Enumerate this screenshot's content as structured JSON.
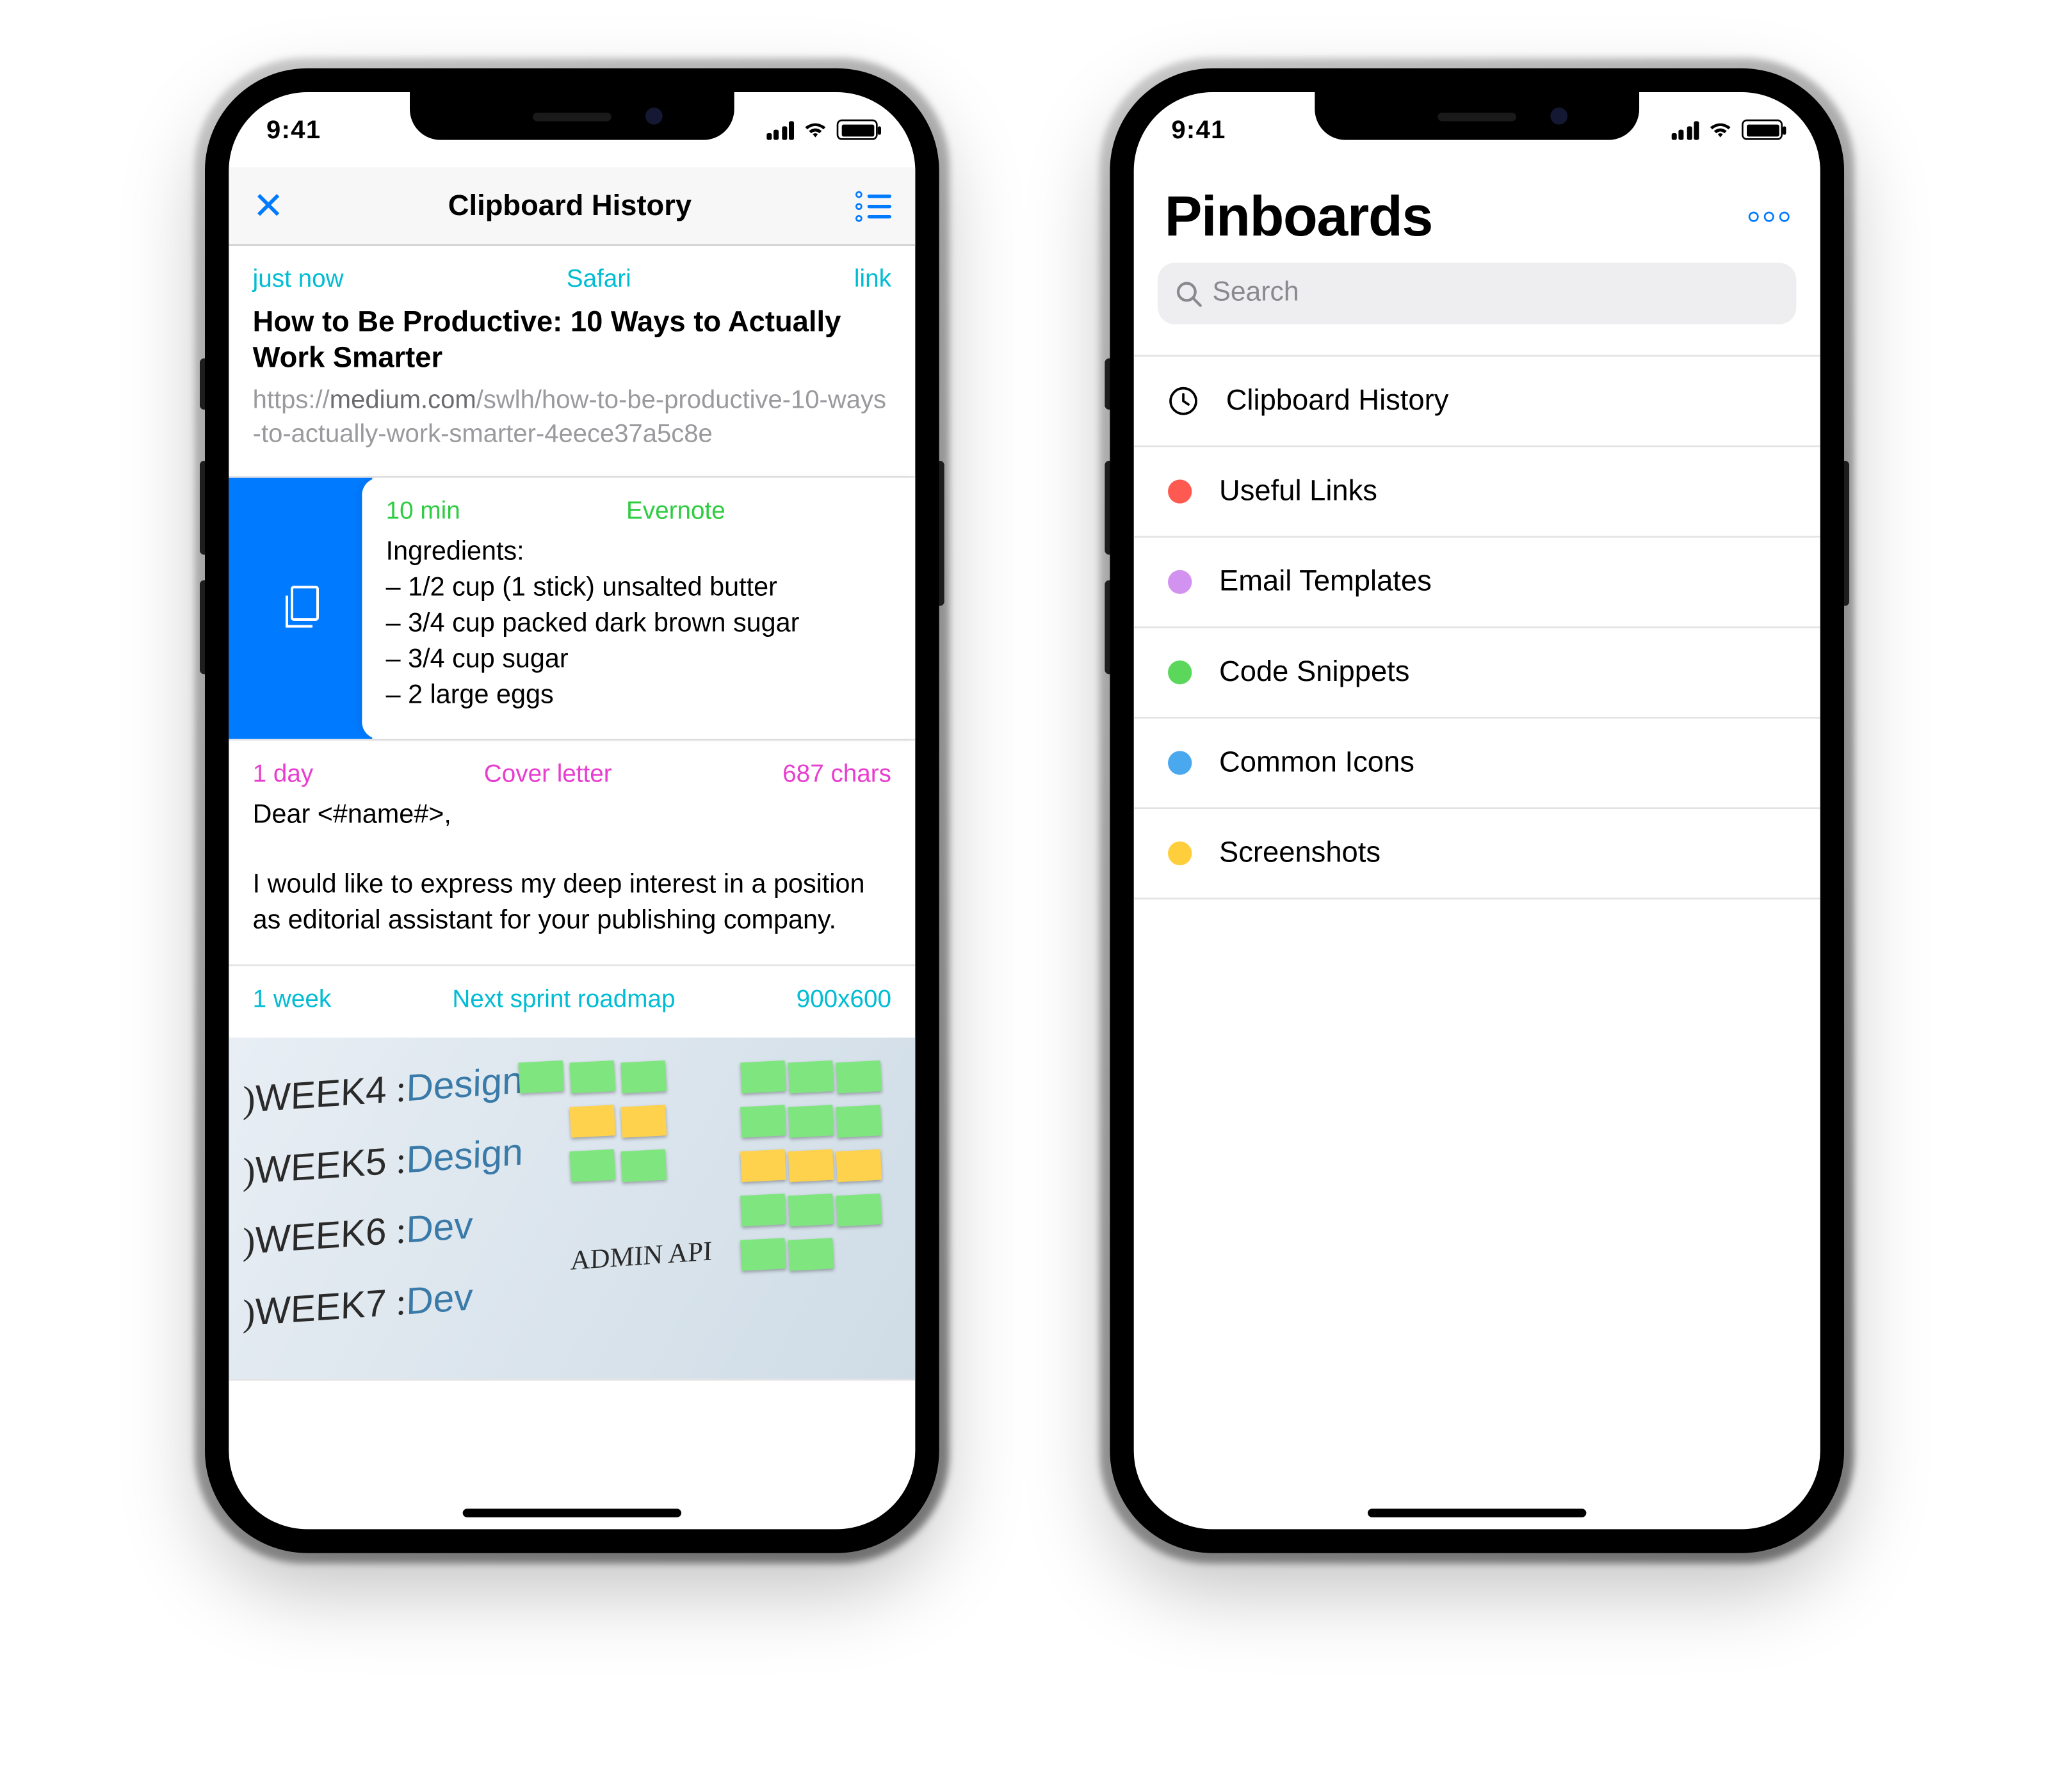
{
  "statusbar": {
    "time": "9:41"
  },
  "left": {
    "nav_title": "Clipboard History",
    "cards": [
      {
        "meta_left": "just now",
        "meta_center": "Safari",
        "meta_right": "link",
        "title": "How to Be Productive: 10 Ways to Actually Work Smarter",
        "url_pre": "https://",
        "url_bold": "medium.com",
        "url_post": "/swlh/how-to-be-productive-10-ways-to-actually-work-smarter-4eece37a5c8e"
      },
      {
        "meta_left": "10 min",
        "meta_center": "Evernote",
        "meta_right": "",
        "body": "Ingredients:\n – 1/2 cup (1 stick) unsalted butter\n – 3/4 cup packed dark brown sugar\n – 3/4 cup sugar\n – 2 large eggs"
      },
      {
        "meta_left": "1 day",
        "meta_center": "Cover letter",
        "meta_right": "687 chars",
        "body": "Dear <#name#>,\n\nI would like to express my deep interest in a position as editorial assistant for your publishing company."
      },
      {
        "meta_left": "1 week",
        "meta_center": "Next sprint roadmap",
        "meta_right": "900x600",
        "weeks": [
          "WEEK4",
          "WEEK5",
          "WEEK6",
          "WEEK7"
        ],
        "week_labels": [
          "Design",
          "Design",
          "Dev",
          "Dev"
        ],
        "note": "ADMIN API"
      }
    ]
  },
  "right": {
    "title": "Pinboards",
    "search_placeholder": "Search",
    "rows": [
      {
        "icon": "clock",
        "label": "Clipboard History"
      },
      {
        "color": "#ff5a52",
        "label": "Useful Links"
      },
      {
        "color": "#d292ef",
        "label": "Email Templates"
      },
      {
        "color": "#5bd75b",
        "label": "Code Snippets"
      },
      {
        "color": "#4aa8ef",
        "label": "Common Icons"
      },
      {
        "color": "#ffce3d",
        "label": "Screenshots"
      }
    ]
  }
}
